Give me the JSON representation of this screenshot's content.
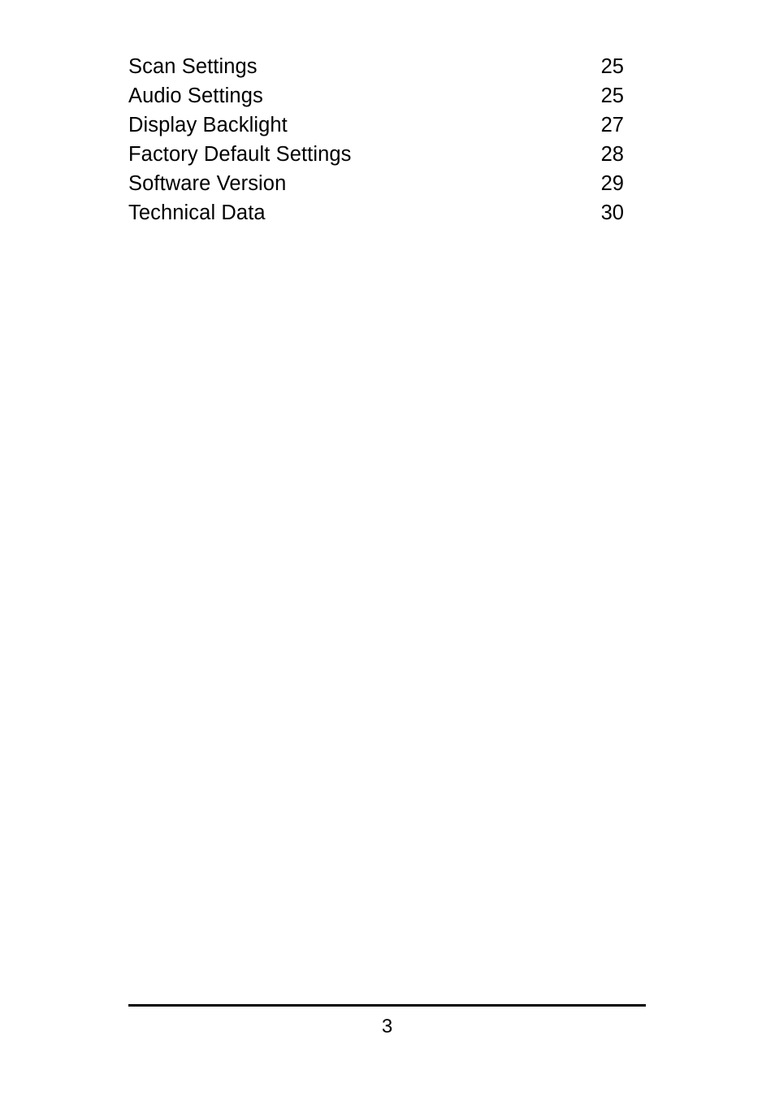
{
  "document": {
    "page_number_footer": "3"
  },
  "toc": {
    "entries": [
      {
        "title": "Scan Settings",
        "page": "25"
      },
      {
        "title": "Audio Settings",
        "page": "25"
      },
      {
        "title": "Display Backlight",
        "page": "27"
      },
      {
        "title": "Factory Default Settings",
        "page": "28"
      },
      {
        "title": "Software Version",
        "page": "29"
      },
      {
        "title": "Technical Data",
        "page": "30"
      }
    ]
  },
  "colors": {
    "text": "#000000",
    "background": "#ffffff",
    "rule": "#000000"
  }
}
